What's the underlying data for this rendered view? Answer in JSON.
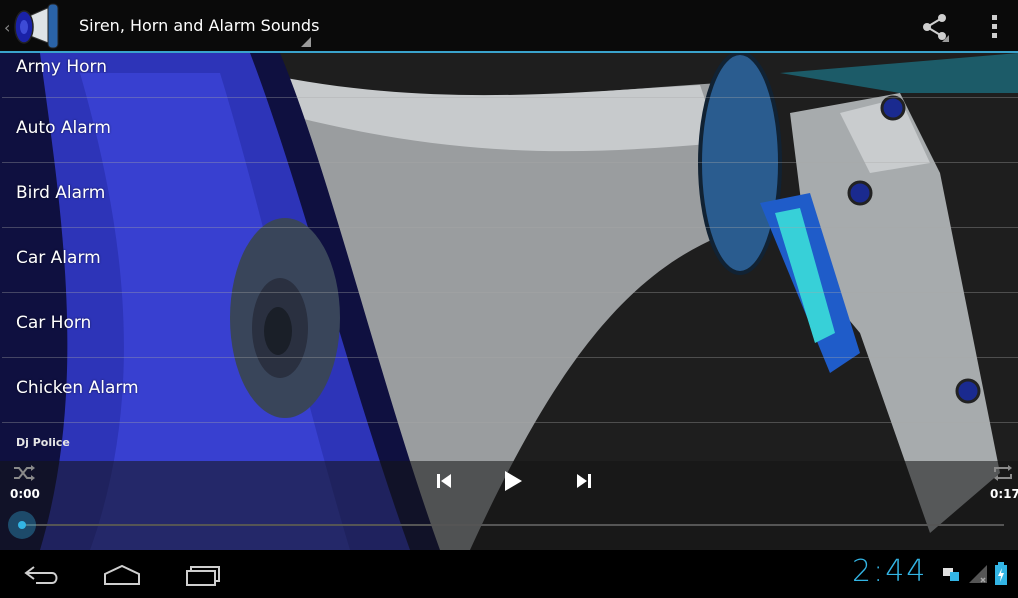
{
  "app": {
    "title": "Siren, Horn and Alarm Sounds",
    "icon": "megaphone-icon"
  },
  "actionbar": {
    "share_icon": "share-icon",
    "overflow_icon": "overflow-menu-icon"
  },
  "sound_list": {
    "items": [
      {
        "label": "Army Horn"
      },
      {
        "label": "Auto Alarm"
      },
      {
        "label": "Bird Alarm"
      },
      {
        "label": "Car Alarm"
      },
      {
        "label": "Car Horn"
      },
      {
        "label": "Chicken Alarm"
      }
    ]
  },
  "player": {
    "now_playing": "Dj Police",
    "time_current": "0:00",
    "time_total": "0:17",
    "progress": 0
  },
  "system_bar": {
    "clock": "2:44"
  },
  "colors": {
    "accent": "#33b5e5",
    "actionbar_bg": "#0a0a0a",
    "divider": "#3aa3cc"
  }
}
